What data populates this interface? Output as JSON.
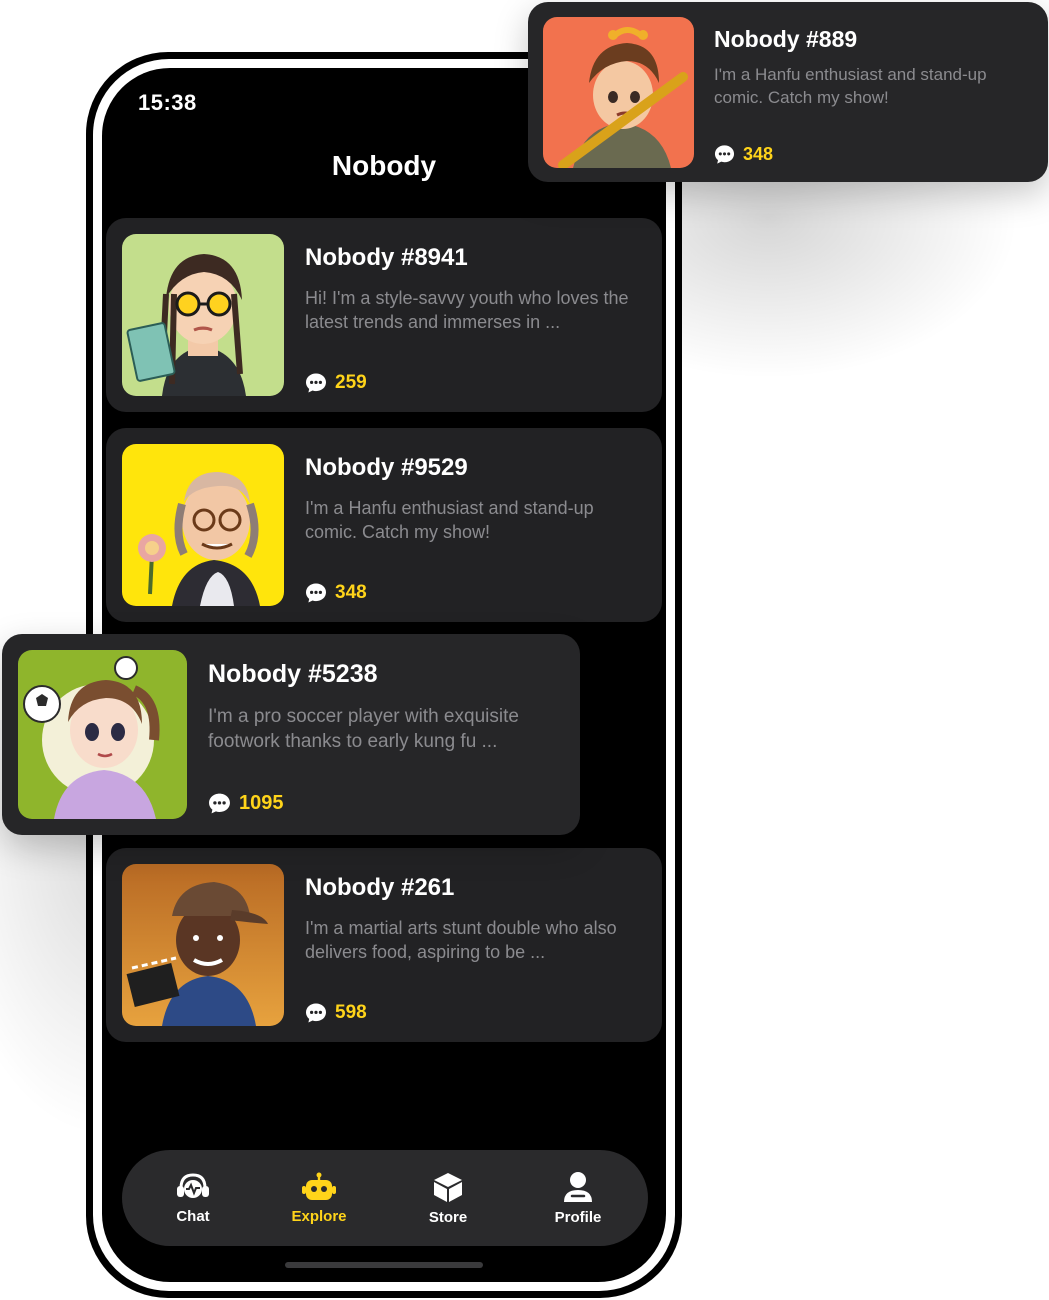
{
  "status_bar": {
    "time": "15:38"
  },
  "page_title": "Nobody",
  "cards": [
    {
      "name": "Nobody #8941",
      "description": "Hi! I'm a style-savvy youth who loves the latest trends and immerses in ...",
      "message_count": "259",
      "avatar_bg": "#c3de8c"
    },
    {
      "name": "Nobody #9529",
      "description": "I'm a Hanfu enthusiast and stand-up comic. Catch my show!",
      "message_count": "348",
      "avatar_bg": "#ffe50c"
    },
    {
      "name": "Nobody #5238",
      "description": "I'm a pro soccer player with exquisite footwork thanks to early kung fu ...",
      "message_count": "1095",
      "avatar_bg": "#8fb52c"
    },
    {
      "name": "Nobody #261",
      "description": "I'm a martial arts stunt double who also delivers food, aspiring to be ...",
      "message_count": "598",
      "avatar_bg": "#d98a34"
    }
  ],
  "featured_card": {
    "name": "Nobody #889",
    "description": "I'm a Hanfu enthusiast and stand-up comic. Catch my show!",
    "message_count": "348",
    "avatar_bg": "#f2724e"
  },
  "tabbar": {
    "items": [
      {
        "label": "Chat",
        "icon": "headset-chat-icon",
        "active": false
      },
      {
        "label": "Explore",
        "icon": "robot-icon",
        "active": true
      },
      {
        "label": "Store",
        "icon": "cube-box-icon",
        "active": false
      },
      {
        "label": "Profile",
        "icon": "person-icon",
        "active": false
      }
    ]
  },
  "colors": {
    "accent": "#ffd41a",
    "card_bg": "#222224",
    "screen_bg": "#000000",
    "muted_text": "#8b8b8f"
  }
}
